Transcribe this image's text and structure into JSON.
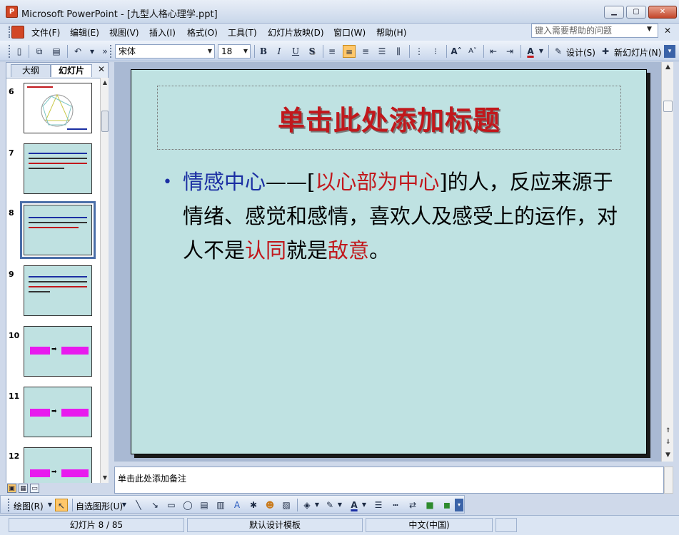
{
  "window": {
    "title": "Microsoft PowerPoint - [九型人格心理学.ppt]",
    "app_icon": "P",
    "min": "▁",
    "max": "▢",
    "close": "✕"
  },
  "menu": [
    {
      "label": "文件(F)"
    },
    {
      "label": "编辑(E)"
    },
    {
      "label": "视图(V)"
    },
    {
      "label": "插入(I)"
    },
    {
      "label": "格式(O)"
    },
    {
      "label": "工具(T)"
    },
    {
      "label": "幻灯片放映(D)"
    },
    {
      "label": "窗口(W)"
    },
    {
      "label": "帮助(H)"
    }
  ],
  "help": {
    "placeholder": "键入需要帮助的问题",
    "drop": "▼",
    "close": "✕"
  },
  "toolbar": {
    "font": "宋体",
    "size": "18",
    "bold": "B",
    "italic": "I",
    "underline": "U",
    "shadow": "S",
    "design_label": "设计(S)",
    "new_slide_label": "新幻灯片(N)",
    "font_color_glyph": "A"
  },
  "left_pane": {
    "tabs": [
      {
        "label": "大纲"
      },
      {
        "label": "幻灯片"
      }
    ],
    "close": "✕",
    "thumbnails": [
      {
        "num": "6"
      },
      {
        "num": "7"
      },
      {
        "num": "8"
      },
      {
        "num": "9"
      },
      {
        "num": "10"
      },
      {
        "num": "11"
      },
      {
        "num": "12"
      }
    ],
    "selected": "8"
  },
  "slide": {
    "title": "单击此处添加标题",
    "bullet": "•",
    "body": {
      "part1": "情感中心",
      "part2": "——[",
      "part3": "以心部为中心",
      "part4": "]的人，反应来源于情绪、感觉和感情，喜欢人及感受上的运作，对人不是",
      "part5": "认同",
      "part6": "就是",
      "part7": "敌意",
      "part8": "。"
    }
  },
  "notes": {
    "placeholder": "单击此处添加备注"
  },
  "drawing": {
    "draw_label": "绘图(R)",
    "autoshape_label": "自选图形(U)"
  },
  "status": {
    "slide_info": "幻灯片 8 / 85",
    "template": "默认设计模板",
    "language": "中文(中国)"
  },
  "colors": {
    "title_red": "#c1181c",
    "blue_text": "#1b2fa3",
    "slide_bg": "#bfe2e2",
    "thumb_magenta": "#e81aee"
  }
}
